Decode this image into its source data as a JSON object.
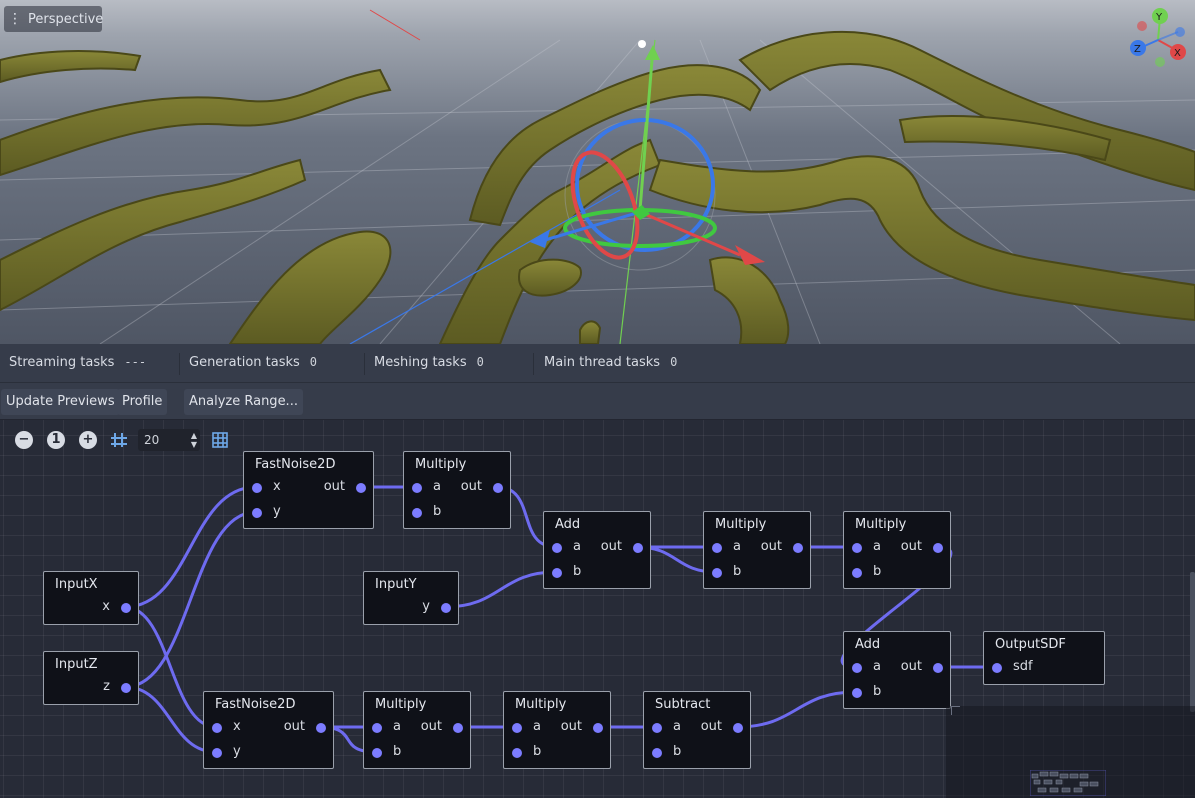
{
  "viewport": {
    "menu_icon": "vertical-dots-icon",
    "perspective_label": "Perspective",
    "gizmo_axes": {
      "y": "Y",
      "z": "Z",
      "x": "X"
    },
    "colors": {
      "terrain": "#6f6e2a",
      "terrain_dark": "#4d4c1c",
      "axis_x": "#e04848",
      "axis_y": "#70d050",
      "axis_z": "#3a78e8"
    }
  },
  "stats": [
    {
      "label": "Streaming tasks",
      "value": "---"
    },
    {
      "label": "Generation tasks",
      "value": "0"
    },
    {
      "label": "Meshing tasks",
      "value": "0"
    },
    {
      "label": "Main thread tasks",
      "value": "0"
    }
  ],
  "toolbar": {
    "update_previews": "Update Previews",
    "profile": "Profile",
    "analyze_range": "Analyze Range..."
  },
  "graph_controls": {
    "zoom_out_icon": "minus-circle-icon",
    "zoom_reset_label": "1",
    "zoom_in_icon": "plus-circle-icon",
    "snap_icon": "snap-grid-icon",
    "snap_value": "20",
    "minimap_icon": "minimap-icon"
  },
  "wire_color": "#6e6bf0",
  "nodes": [
    {
      "id": "fastnoise1",
      "title": "FastNoise2D",
      "inputs": [
        "x",
        "y"
      ],
      "outputs": [
        "out"
      ]
    },
    {
      "id": "multiply1",
      "title": "Multiply",
      "inputs": [
        "a",
        "b"
      ],
      "outputs": [
        "out"
      ]
    },
    {
      "id": "add1",
      "title": "Add",
      "inputs": [
        "a",
        "b"
      ],
      "outputs": [
        "out"
      ]
    },
    {
      "id": "multiply2",
      "title": "Multiply",
      "inputs": [
        "a",
        "b"
      ],
      "outputs": [
        "out"
      ]
    },
    {
      "id": "multiply3",
      "title": "Multiply",
      "inputs": [
        "a",
        "b"
      ],
      "outputs": [
        "out"
      ]
    },
    {
      "id": "inputx",
      "title": "InputX",
      "inputs": [],
      "outputs": [
        "x"
      ]
    },
    {
      "id": "inputy",
      "title": "InputY",
      "inputs": [],
      "outputs": [
        "y"
      ]
    },
    {
      "id": "inputz",
      "title": "InputZ",
      "inputs": [],
      "outputs": [
        "z"
      ]
    },
    {
      "id": "add2",
      "title": "Add",
      "inputs": [
        "a",
        "b"
      ],
      "outputs": [
        "out"
      ]
    },
    {
      "id": "outputsdf",
      "title": "OutputSDF",
      "inputs": [
        "sdf"
      ],
      "outputs": []
    },
    {
      "id": "fastnoise2",
      "title": "FastNoise2D",
      "inputs": [
        "x",
        "y"
      ],
      "outputs": [
        "out"
      ]
    },
    {
      "id": "multiply4",
      "title": "Multiply",
      "inputs": [
        "a",
        "b"
      ],
      "outputs": [
        "out"
      ]
    },
    {
      "id": "multiply5",
      "title": "Multiply",
      "inputs": [
        "a",
        "b"
      ],
      "outputs": [
        "out"
      ]
    },
    {
      "id": "subtract1",
      "title": "Subtract",
      "inputs": [
        "a",
        "b"
      ],
      "outputs": [
        "out"
      ]
    }
  ],
  "connections": [
    [
      "inputx",
      "x",
      "fastnoise1",
      "x"
    ],
    [
      "inputz",
      "z",
      "fastnoise1",
      "y"
    ],
    [
      "inputx",
      "x",
      "fastnoise2",
      "x"
    ],
    [
      "inputz",
      "z",
      "fastnoise2",
      "y"
    ],
    [
      "fastnoise1",
      "out",
      "multiply1",
      "a"
    ],
    [
      "multiply1",
      "out",
      "add1",
      "a"
    ],
    [
      "inputy",
      "y",
      "add1",
      "b"
    ],
    [
      "add1",
      "out",
      "multiply2",
      "a"
    ],
    [
      "add1",
      "out",
      "multiply2",
      "b"
    ],
    [
      "multiply2",
      "out",
      "multiply3",
      "a"
    ],
    [
      "multiply3",
      "out",
      "add2",
      "a"
    ],
    [
      "fastnoise2",
      "out",
      "multiply4",
      "a"
    ],
    [
      "fastnoise2",
      "out",
      "multiply4",
      "b"
    ],
    [
      "multiply4",
      "out",
      "multiply5",
      "a"
    ],
    [
      "multiply5",
      "out",
      "subtract1",
      "a"
    ],
    [
      "subtract1",
      "out",
      "add2",
      "b"
    ],
    [
      "add2",
      "out",
      "outputsdf",
      "sdf"
    ]
  ]
}
